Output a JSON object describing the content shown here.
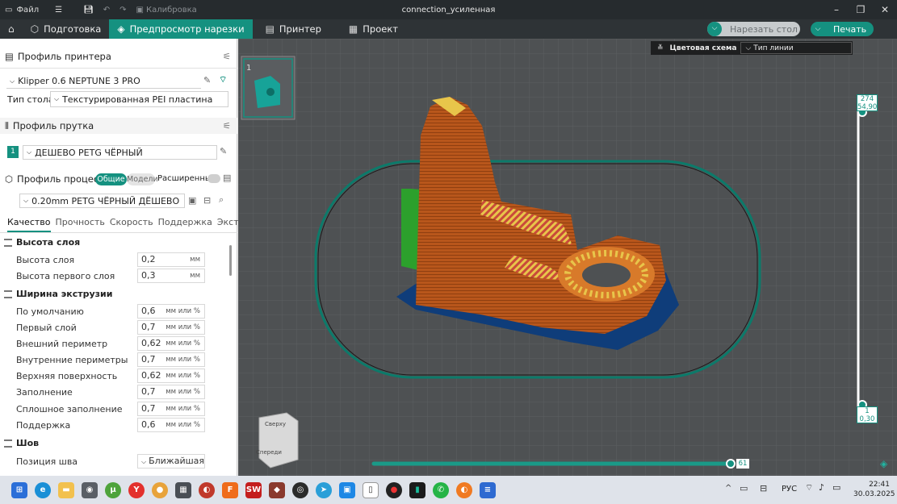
{
  "titlebar": {
    "file": "Файл",
    "calibration": "Калибровка",
    "title": "connection_усиленная"
  },
  "tabs": [
    {
      "label": "Подготовка",
      "icon": "cube-icon"
    },
    {
      "label": "Предпросмотр нарезки",
      "icon": "layers-icon"
    },
    {
      "label": "Принтер",
      "icon": "printer-icon"
    },
    {
      "label": "Проект",
      "icon": "project-icon"
    }
  ],
  "actions": {
    "slice_plate": "Нарезать стол",
    "print": "Печать"
  },
  "printer": {
    "section": "Профиль принтера",
    "name": "Klipper 0.6 NEPTUNE 3 PRO",
    "bed_label": "Тип стола",
    "bed_value": "Текстурированная PEI пластина"
  },
  "filament": {
    "section": "Профиль прутка",
    "index": "1",
    "name": "ДЕШЕВО PETG ЧЁРНЫЙ"
  },
  "process": {
    "section": "Профиль процесса",
    "toggle_common": "Общие",
    "toggle_models": "Модели",
    "advanced": "Расширенный",
    "preset": "0.20mm PETG ЧЁРНЫЙ ДЁШЕВО"
  },
  "subtabs": [
    "Качество",
    "Прочность",
    "Скорость",
    "Поддержка",
    "Экструд..."
  ],
  "groups": {
    "layer": {
      "title": "Высота слоя",
      "rows": [
        {
          "label": "Высота слоя",
          "value": "0,2",
          "unit": "мм"
        },
        {
          "label": "Высота первого слоя",
          "value": "0,3",
          "unit": "мм"
        }
      ]
    },
    "width": {
      "title": "Ширина экструзии",
      "rows": [
        {
          "label": "По умолчанию",
          "value": "0,6",
          "unit": "мм или %"
        },
        {
          "label": "Первый слой",
          "value": "0,7",
          "unit": "мм или %"
        },
        {
          "label": "Внешний периметр",
          "value": "0,62",
          "unit": "мм или %"
        },
        {
          "label": "Внутренние периметры",
          "value": "0,7",
          "unit": "мм или %"
        },
        {
          "label": "Верхняя поверхность",
          "value": "0,62",
          "unit": "мм или %"
        },
        {
          "label": "Заполнение",
          "value": "0,7",
          "unit": "мм или %"
        },
        {
          "label": "Сплошное заполнение",
          "value": "0,7",
          "unit": "мм или %"
        },
        {
          "label": "Поддержка",
          "value": "0,6",
          "unit": "мм или %"
        }
      ]
    },
    "seam": {
      "title": "Шов",
      "rows": [
        {
          "label": "Позиция шва",
          "value": "Ближайшая"
        }
      ]
    }
  },
  "viewport": {
    "plate_number": "1",
    "color_scheme_label": "Цветовая схема",
    "color_scheme_value": "Тип линии",
    "layer_top": "274",
    "height_top": "54,90",
    "layer_bottom": "1",
    "height_bottom": "0,30",
    "move_value": "61",
    "cube_top": "Сверху",
    "cube_front": "Спереди"
  },
  "taskbar": {
    "lang": "РУС",
    "time": "22:41",
    "date": "30.03.2025"
  }
}
